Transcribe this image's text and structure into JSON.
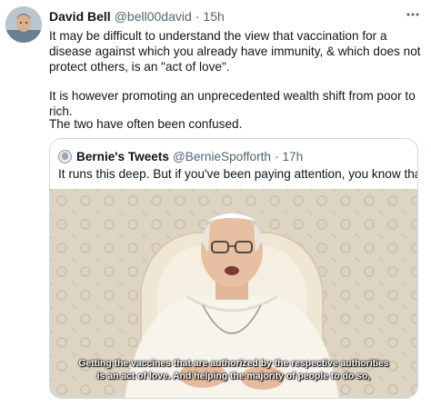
{
  "tweet": {
    "author": {
      "name": "David Bell",
      "handle": "@bell00david",
      "separator": "·",
      "time": "15h"
    },
    "more_icon": "more-horizontal-icon",
    "paragraphs": [
      "It may be difficult to understand the view that vaccination for a disease against which you already have immunity, & which does not protect others, is an \"act of love\".",
      "It is however promoting an unprecedented wealth shift from poor to rich.",
      "The two have often been confused."
    ]
  },
  "quoted_tweet": {
    "author": {
      "name": "Bernie's Tweets",
      "handle": "@BernieSpofforth",
      "separator": "·",
      "time": "17h"
    },
    "text": "It runs this deep. But if you've been paying attention, you know that.",
    "media": {
      "caption_line1": "Getting the vaccines that are authorized by the respective authorities",
      "caption_line2": "is an act of love. And helping the majority of people to do so,"
    }
  }
}
